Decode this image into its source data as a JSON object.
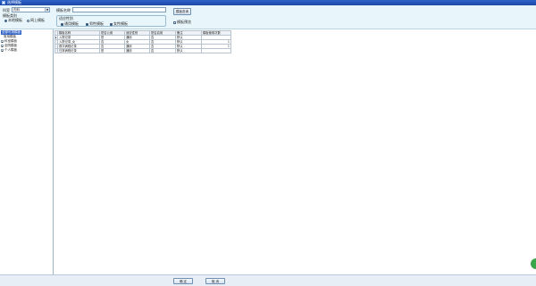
{
  "window": {
    "title": "选择模板"
  },
  "top": {
    "dept_label": "科室",
    "dept_value": "内科",
    "template_category_label": "模板类别",
    "radio_local": "本地模板",
    "radio_online": "网上模板",
    "template_name_label": "模板名称",
    "template_name_value": "",
    "scope_label": "适应性别",
    "check_universal": "通用模板",
    "check_male": "男性模板",
    "check_female": "女性模板",
    "search_button": "模板查询",
    "template_preview_label": "模板预览"
  },
  "tree": {
    "items": [
      {
        "label": "全部可用模板",
        "selected": true
      },
      {
        "label": "常用模板"
      },
      {
        "label": "科室模板"
      },
      {
        "label": "全院模板"
      },
      {
        "label": "个人模板"
      }
    ]
  },
  "grid": {
    "columns": [
      "模板名称",
      "是否公用",
      "适应性别",
      "是否启用",
      "备注",
      "模板使用次数"
    ],
    "rows": [
      [
        "入院记录",
        "是",
        "通用",
        "否",
        "默认",
        ""
      ],
      [
        "入院记录_女",
        "否",
        "女",
        "否",
        "默认",
        "1"
      ],
      [
        "首次病程记录",
        "否",
        "通用",
        "否",
        "默认",
        "1"
      ],
      [
        "日常病程记录",
        "是",
        "通用",
        "否",
        "默认",
        ""
      ]
    ]
  },
  "footer": {
    "ok_label": "确 定",
    "cancel_label": "取 消"
  }
}
